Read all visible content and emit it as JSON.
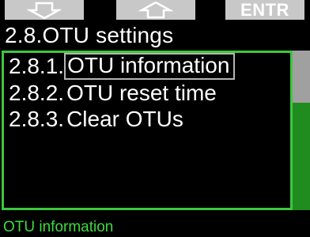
{
  "softkeys": {
    "down": {
      "icon": "arrow-down-icon"
    },
    "up": {
      "icon": "arrow-up-icon"
    },
    "enter": {
      "label": "ENTR"
    }
  },
  "title": "2.8.OTU settings",
  "menu": {
    "items": [
      {
        "number": "2.8.1.",
        "label": "OTU information",
        "selected": true
      },
      {
        "number": "2.8.2.",
        "label": "OTU reset time",
        "selected": false
      },
      {
        "number": "2.8.3.",
        "label": "Clear OTUs",
        "selected": false
      }
    ]
  },
  "scrollbar": {
    "position_fraction": 0
  },
  "status": {
    "text": "OTU information"
  },
  "colors": {
    "accent": "#3cc83c",
    "softkey_bg": "#c8c8c8",
    "scroll_track": "#208c20",
    "scroll_thumb": "#a0a0a0",
    "background": "#000000"
  }
}
